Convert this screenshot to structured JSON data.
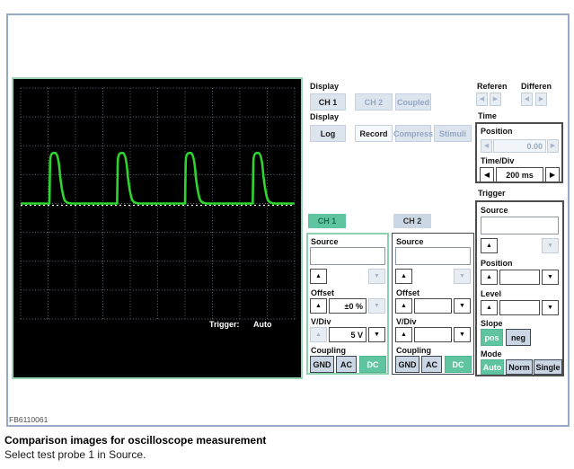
{
  "figure": {
    "id": "FB6110061",
    "caption_title": "Comparison images for oscilloscope measurement",
    "caption_subtitle": "Select test probe 1 in Source."
  },
  "icons": {
    "up": "▲",
    "down": "▼",
    "left": "◀",
    "right": "▶"
  },
  "scope": {
    "trigger_label": "Trigger:",
    "trigger_value": "Auto",
    "grid_cols": 10,
    "grid_rows": 8,
    "baseline_div": 4,
    "pulse_height_divs": 1.75,
    "pulse_start_divs": [
      1.05,
      3.52,
      6.0,
      8.47
    ],
    "waveform_color": "#2ed52e",
    "grid_color": "#5f6e80",
    "zero_line_color": "#ffffff"
  },
  "display_channels": {
    "label": "Display",
    "buttons": [
      {
        "label": "CH 1"
      },
      {
        "label": "CH 2"
      },
      {
        "label": "Coupled"
      }
    ]
  },
  "display_modes": {
    "label": "Display",
    "buttons": [
      {
        "label": "Log"
      },
      {
        "label": "Record"
      },
      {
        "label": "Compress"
      },
      {
        "label": "Stimuli"
      }
    ]
  },
  "reference": {
    "label": "Referen"
  },
  "differential": {
    "label": "Differen"
  },
  "time_panel": {
    "label": "Time",
    "position_label": "Position",
    "position_value": "0.00",
    "timediv_label": "Time/Div",
    "timediv_value": "200 ms"
  },
  "trigger_panel": {
    "label": "Trigger",
    "source_label": "Source",
    "source_value": "",
    "position_label": "Position",
    "position_value": "",
    "level_label": "Level",
    "level_value": "",
    "slope_label": "Slope",
    "slope_options": [
      {
        "label": "pos"
      },
      {
        "label": "neg"
      }
    ],
    "mode_label": "Mode",
    "mode_options": [
      {
        "label": "Auto"
      },
      {
        "label": "Norm"
      },
      {
        "label": "Single"
      }
    ]
  },
  "ch1": {
    "tab_label": "CH 1",
    "source_label": "Source",
    "source_value": "",
    "offset_label": "Offset",
    "offset_value": "±0 %",
    "vdiv_label": "V/Div",
    "vdiv_value": "5 V",
    "coupling_label": "Coupling",
    "coupling_options": [
      {
        "label": "GND"
      },
      {
        "label": "AC"
      },
      {
        "label": "DC"
      }
    ]
  },
  "ch2": {
    "tab_label": "CH 2",
    "source_label": "Source",
    "source_value": "",
    "offset_label": "Offset",
    "offset_value": "",
    "vdiv_label": "V/Div",
    "vdiv_value": "",
    "coupling_label": "Coupling",
    "coupling_options": [
      {
        "label": "GND"
      },
      {
        "label": "AC"
      },
      {
        "label": "DC"
      }
    ]
  },
  "colors": {
    "teal": "#5fc5a0",
    "mint_border": "#8ed1ae",
    "outer_border": "#94aac6",
    "flat_button_bg": "#dce4ee",
    "small_button_bg": "#cbd6e5",
    "waveform_green": "#2ed52e"
  }
}
